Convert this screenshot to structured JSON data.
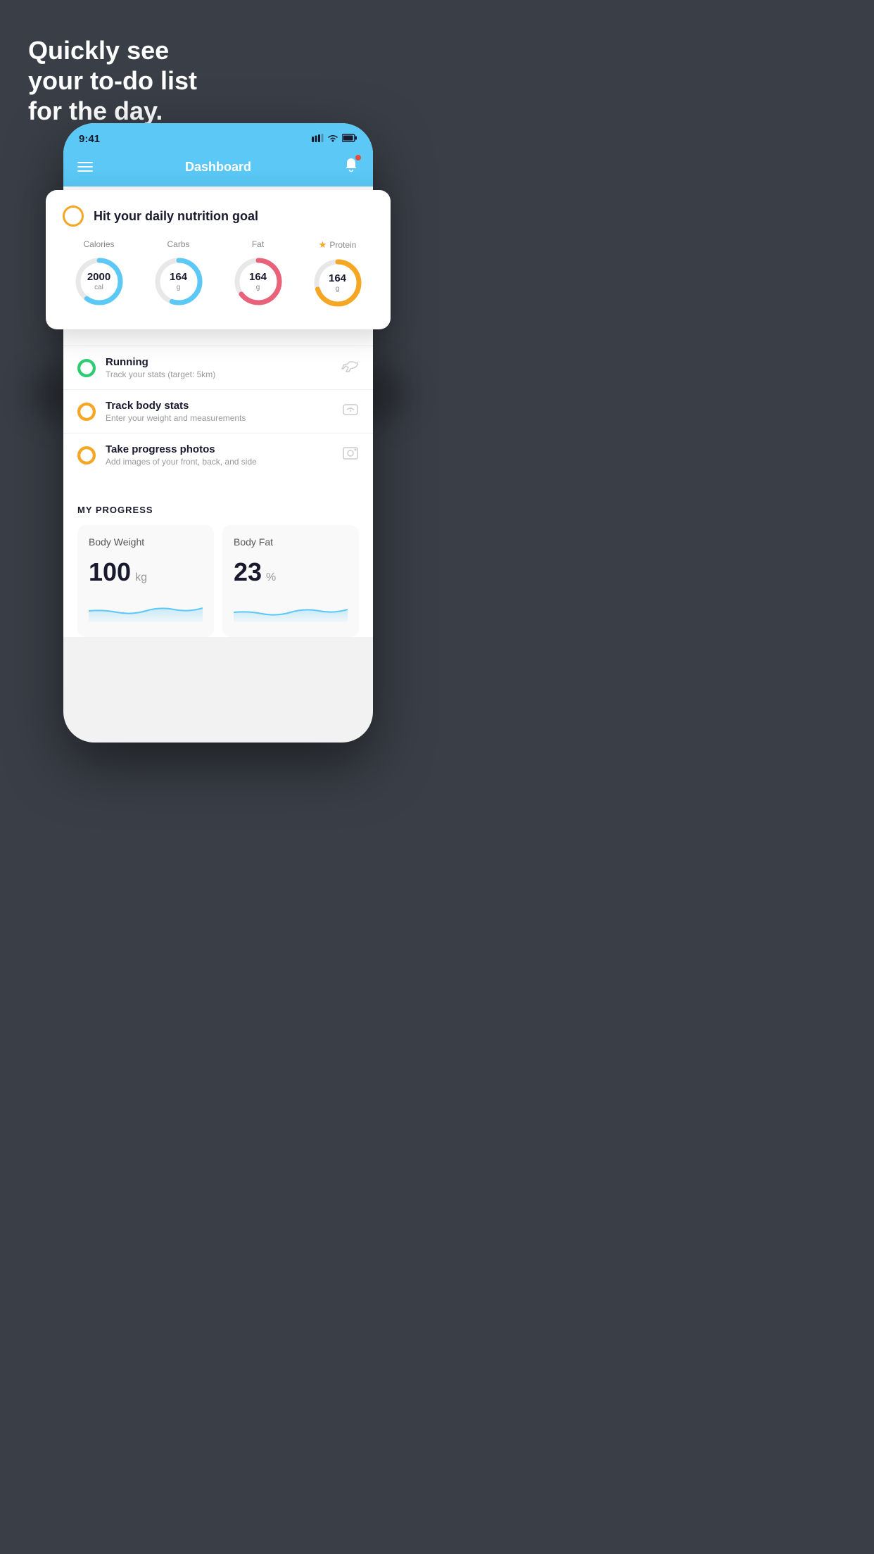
{
  "headline": {
    "line1": "Quickly see",
    "line2": "your to-do list",
    "line3": "for the day."
  },
  "status_bar": {
    "time": "9:41",
    "signal": "▋▋▋",
    "wifi": "WiFi",
    "battery": "🔋"
  },
  "nav": {
    "title": "Dashboard"
  },
  "nutrition_card": {
    "title": "Hit your daily nutrition goal",
    "macros": [
      {
        "label": "Calories",
        "value": "2000",
        "unit": "cal",
        "color": "#5bc8f5",
        "percent": 60,
        "star": false
      },
      {
        "label": "Carbs",
        "value": "164",
        "unit": "g",
        "color": "#5bc8f5",
        "percent": 55,
        "star": false
      },
      {
        "label": "Fat",
        "value": "164",
        "unit": "g",
        "color": "#e8637a",
        "percent": 65,
        "star": false
      },
      {
        "label": "Protein",
        "value": "164",
        "unit": "g",
        "color": "#f5a623",
        "percent": 70,
        "star": true
      }
    ]
  },
  "todo_items": [
    {
      "id": "running",
      "title": "Running",
      "subtitle": "Track your stats (target: 5km)",
      "check_color": "green",
      "icon": "👟"
    },
    {
      "id": "body-stats",
      "title": "Track body stats",
      "subtitle": "Enter your weight and measurements",
      "check_color": "yellow",
      "icon": "⚖"
    },
    {
      "id": "progress-photos",
      "title": "Take progress photos",
      "subtitle": "Add images of your front, back, and side",
      "check_color": "yellow",
      "icon": "🖼"
    }
  ],
  "progress": {
    "section_title": "MY PROGRESS",
    "cards": [
      {
        "title": "Body Weight",
        "value": "100",
        "unit": "kg"
      },
      {
        "title": "Body Fat",
        "value": "23",
        "unit": "%"
      }
    ]
  }
}
